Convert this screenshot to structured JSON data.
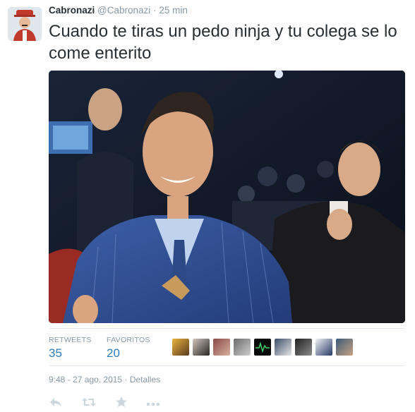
{
  "tweet": {
    "display_name": "Cabronazi",
    "handle": "@Cabronazi",
    "separator": "·",
    "time_ago": "25 min",
    "text": "Cuando te tiras un pedo ninja y tu colega se lo come enterito",
    "avatar_icon": "profile-avatar"
  },
  "stats": {
    "retweets_label": "RETWEETS",
    "retweets_count": "35",
    "favorites_label": "FAVORITOS",
    "favorites_count": "20"
  },
  "meta": {
    "timestamp": "9:48 - 27 ago. 2015",
    "separator": "·",
    "details_link": "Detalles"
  },
  "actions": [
    "reply-icon",
    "retweet-icon",
    "favorite-icon",
    "more-icon"
  ],
  "colors": {
    "link": "#2b7bb9",
    "muted": "#8899a6",
    "text": "#292f33",
    "icon": "#ccd6dd"
  }
}
